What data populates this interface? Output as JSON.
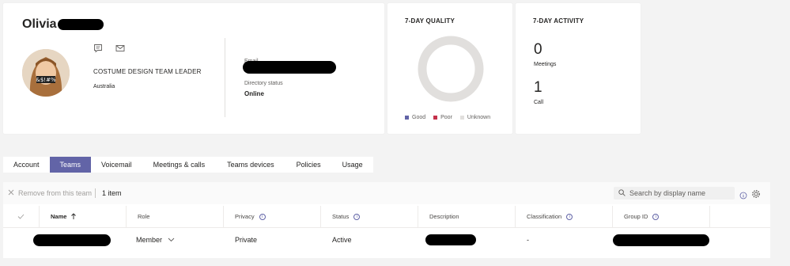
{
  "profile": {
    "first_name": "Olivia",
    "job_title": "COSTUME DESIGN TEAM LEADER",
    "location": "Australia",
    "email_label": "Email",
    "directory_status_label": "Directory status",
    "directory_status": "Online"
  },
  "quality": {
    "title": "7-DAY QUALITY",
    "legend": [
      {
        "label": "Good",
        "color": "#6264a7"
      },
      {
        "label": "Poor",
        "color": "#c4314b"
      },
      {
        "label": "Unknown",
        "color": "#e1dfdd"
      }
    ]
  },
  "activity": {
    "title": "7-DAY ACTIVITY",
    "meetings_count": "0",
    "meetings_label": "Meetings",
    "calls_count": "1",
    "calls_label": "Call"
  },
  "tabs": [
    "Account",
    "Teams",
    "Voicemail",
    "Meetings & calls",
    "Teams devices",
    "Policies",
    "Usage"
  ],
  "active_tab": "Teams",
  "toolbar": {
    "remove_label": "Remove from this team",
    "count_label": "1 item",
    "search_placeholder": "Search by display name"
  },
  "table": {
    "columns": [
      "Name",
      "Role",
      "Privacy",
      "Status",
      "Description",
      "Classification",
      "Group ID"
    ],
    "rows": [
      {
        "role": "Member",
        "privacy": "Private",
        "status": "Active",
        "classification": "-"
      }
    ]
  },
  "colors": {
    "accent": "#6264a7",
    "background": "#f3f3f3"
  }
}
